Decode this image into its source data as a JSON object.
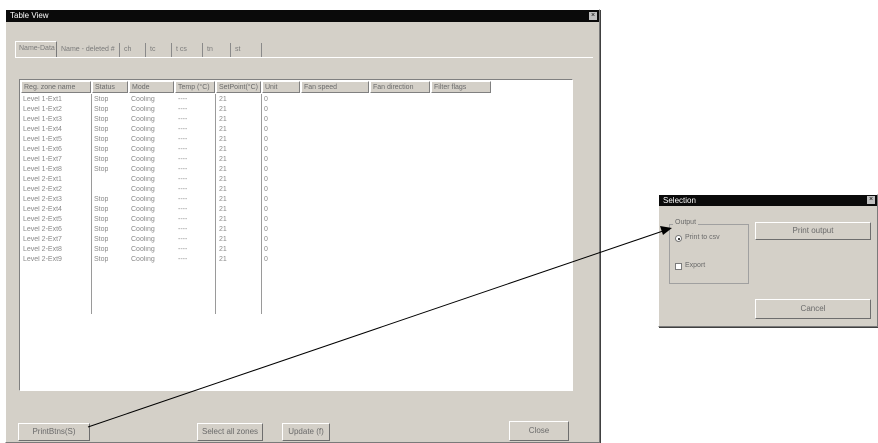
{
  "main_window": {
    "title": "Table View",
    "close_glyph": "×",
    "tabs": [
      {
        "label": "Name-Data",
        "active": true
      },
      {
        "label": "Name - deleted #"
      },
      {
        "label": "ch"
      },
      {
        "label": "tc"
      },
      {
        "label": "t cs"
      },
      {
        "label": "tn"
      },
      {
        "label": "st"
      }
    ],
    "columns": [
      "Reg. zone name",
      "Status",
      "Mode",
      "Temp (°C)",
      "SetPoint(°C)",
      "Unit",
      "Fan speed",
      "Fan direction",
      "Filter flags"
    ],
    "rows": [
      [
        "Level 1-Ext1",
        "Stop",
        "Cooling",
        "----",
        "21",
        "0"
      ],
      [
        "Level 1-Ext2",
        "Stop",
        "Cooling",
        "----",
        "21",
        "0"
      ],
      [
        "Level 1-Ext3",
        "Stop",
        "Cooling",
        "----",
        "21",
        "0"
      ],
      [
        "Level 1-Ext4",
        "Stop",
        "Cooling",
        "----",
        "21",
        "0"
      ],
      [
        "Level 1-Ext5",
        "Stop",
        "Cooling",
        "----",
        "21",
        "0"
      ],
      [
        "Level 1-Ext6",
        "Stop",
        "Cooling",
        "----",
        "21",
        "0"
      ],
      [
        "Level 1-Ext7",
        "Stop",
        "Cooling",
        "----",
        "21",
        "0"
      ],
      [
        "Level 1-Ext8",
        "Stop",
        "Cooling",
        "----",
        "21",
        "0"
      ],
      [
        "Level 2-Ext1",
        "",
        "Cooling",
        "----",
        "21",
        "0"
      ],
      [
        "Level 2-Ext2",
        "",
        "Cooling",
        "----",
        "21",
        "0"
      ],
      [
        "Level 2-Ext3",
        "Stop",
        "Cooling",
        "----",
        "21",
        "0"
      ],
      [
        "Level 2-Ext4",
        "Stop",
        "Cooling",
        "----",
        "21",
        "0"
      ],
      [
        "Level 2-Ext5",
        "Stop",
        "Cooling",
        "----",
        "21",
        "0"
      ],
      [
        "Level 2-Ext6",
        "Stop",
        "Cooling",
        "----",
        "21",
        "0"
      ],
      [
        "Level 2-Ext7",
        "Stop",
        "Cooling",
        "----",
        "21",
        "0"
      ],
      [
        "Level 2-Ext8",
        "Stop",
        "Cooling",
        "----",
        "21",
        "0"
      ],
      [
        "Level 2-Ext9",
        "Stop",
        "Cooling",
        "----",
        "21",
        "0"
      ]
    ],
    "buttons": {
      "print": "PrintBtns(S)",
      "select_all": "Select all zones",
      "update": "Update (f)",
      "close": "Close"
    }
  },
  "dialog": {
    "title": "Selection",
    "close_glyph": "×",
    "group_label": "Output",
    "radio_label": "Print to csv",
    "checkbox_label": "Export",
    "buttons": {
      "ok": "Print output",
      "cancel": "Cancel"
    }
  }
}
